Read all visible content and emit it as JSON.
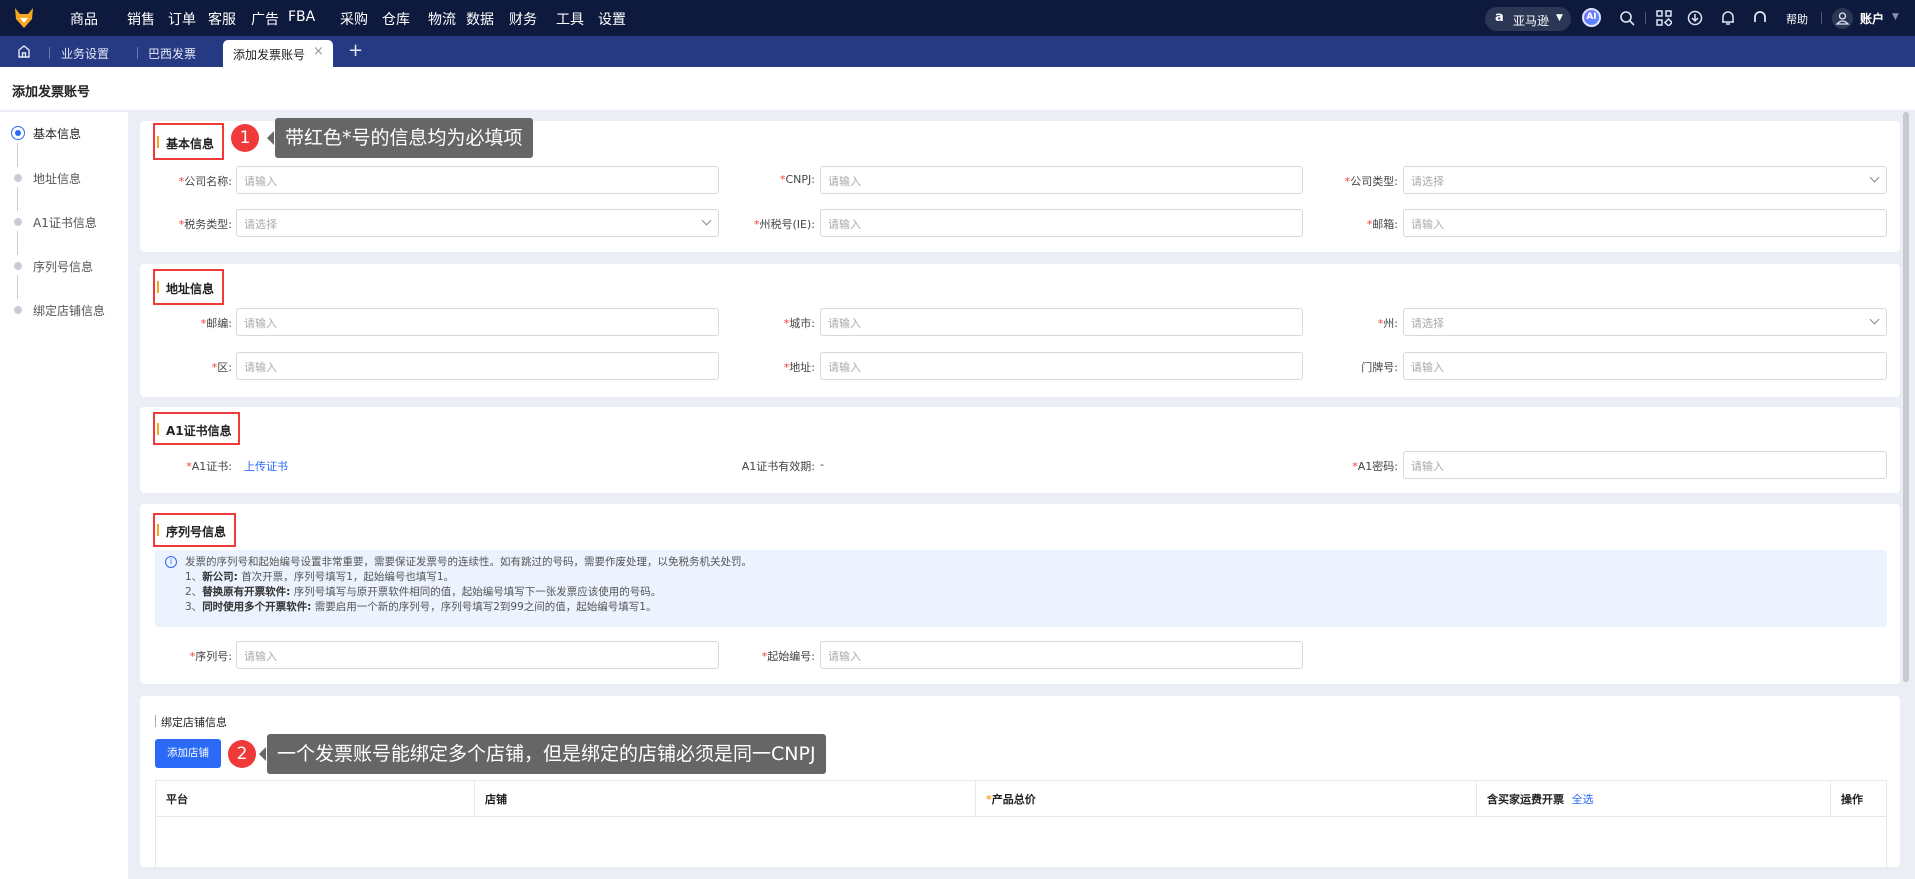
{
  "topnav": {
    "items": [
      "商品",
      "销售",
      "订单",
      "客服",
      "广告",
      "FBA",
      "采购",
      "仓库",
      "物流",
      "数据",
      "财务",
      "工具",
      "设置"
    ],
    "platform": "亚马逊",
    "ai": "AI",
    "help": "帮助",
    "account": "账户"
  },
  "tabs": {
    "items": [
      "业务设置",
      "巴西发票"
    ],
    "active": "添加发票账号",
    "close": "×",
    "add": "+"
  },
  "page_title": "添加发票账号",
  "steps": [
    "基本信息",
    "地址信息",
    "A1证书信息",
    "序列号信息",
    "绑定店铺信息"
  ],
  "basic": {
    "title": "基本信息",
    "fields": [
      {
        "label": "公司名称:",
        "placeholder": "请输入"
      },
      {
        "label": "CNPJ:",
        "placeholder": "请输入"
      },
      {
        "label": "公司类型:",
        "placeholder": "请选择"
      },
      {
        "label": "税务类型:",
        "placeholder": "请选择"
      },
      {
        "label": "州税号(IE):",
        "placeholder": "请输入"
      },
      {
        "label": "邮箱:",
        "placeholder": "请输入"
      }
    ]
  },
  "address": {
    "title": "地址信息",
    "fields": [
      {
        "label": "邮编:",
        "placeholder": "请输入"
      },
      {
        "label": "城市:",
        "placeholder": "请输入"
      },
      {
        "label": "州:",
        "placeholder": "请选择"
      },
      {
        "label": "区:",
        "placeholder": "请输入"
      },
      {
        "label": "地址:",
        "placeholder": "请输入"
      },
      {
        "label": "门牌号:",
        "placeholder": "请输入"
      }
    ]
  },
  "cert": {
    "title": "A1证书信息",
    "cert_label": "A1证书:",
    "upload": "上传证书",
    "validity_label": "A1证书有效期:",
    "validity_value": "-",
    "password_label": "A1密码:",
    "password_placeholder": "请输入"
  },
  "serial": {
    "title": "序列号信息",
    "info": "发票的序列号和起始编号设置非常重要，需要保证发票号的连续性。如有跳过的号码，需要作废处理，以免税务机关处罚。",
    "rules": [
      {
        "no": "1、",
        "key": "新公司:",
        "text": "首次开票，序列号填写1，起始编号也填写1。"
      },
      {
        "no": "2、",
        "key": "替换原有开票软件:",
        "text": "序列号填写与原开票软件相同的值，起始编号填写下一张发票应该使用的号码。"
      },
      {
        "no": "3、",
        "key": "同时使用多个开票软件:",
        "text": "需要启用一个新的序列号，序列号填写2到99之间的值，起始编号填写1。"
      }
    ],
    "serial_label": "序列号:",
    "start_label": "起始编号:",
    "placeholder": "请输入"
  },
  "store": {
    "title": "绑定店铺信息",
    "add": "添加店铺",
    "columns": [
      "平台",
      "店铺",
      "产品总价",
      "含买家运费开票",
      "操作"
    ],
    "select_all": "全选"
  },
  "annotations": [
    {
      "no": "1",
      "text": "带红色*号的信息均为必填项"
    },
    {
      "no": "2",
      "text": "一个发票账号能绑定多个店铺，但是绑定的店铺必须是同一CNPJ"
    }
  ],
  "req_mark": "*",
  "colors": {
    "nav": "#0d1a3e",
    "tabbar": "#263a84",
    "primary": "#2b6af7",
    "required": "#f04134",
    "annotation": "#f03a3a"
  }
}
